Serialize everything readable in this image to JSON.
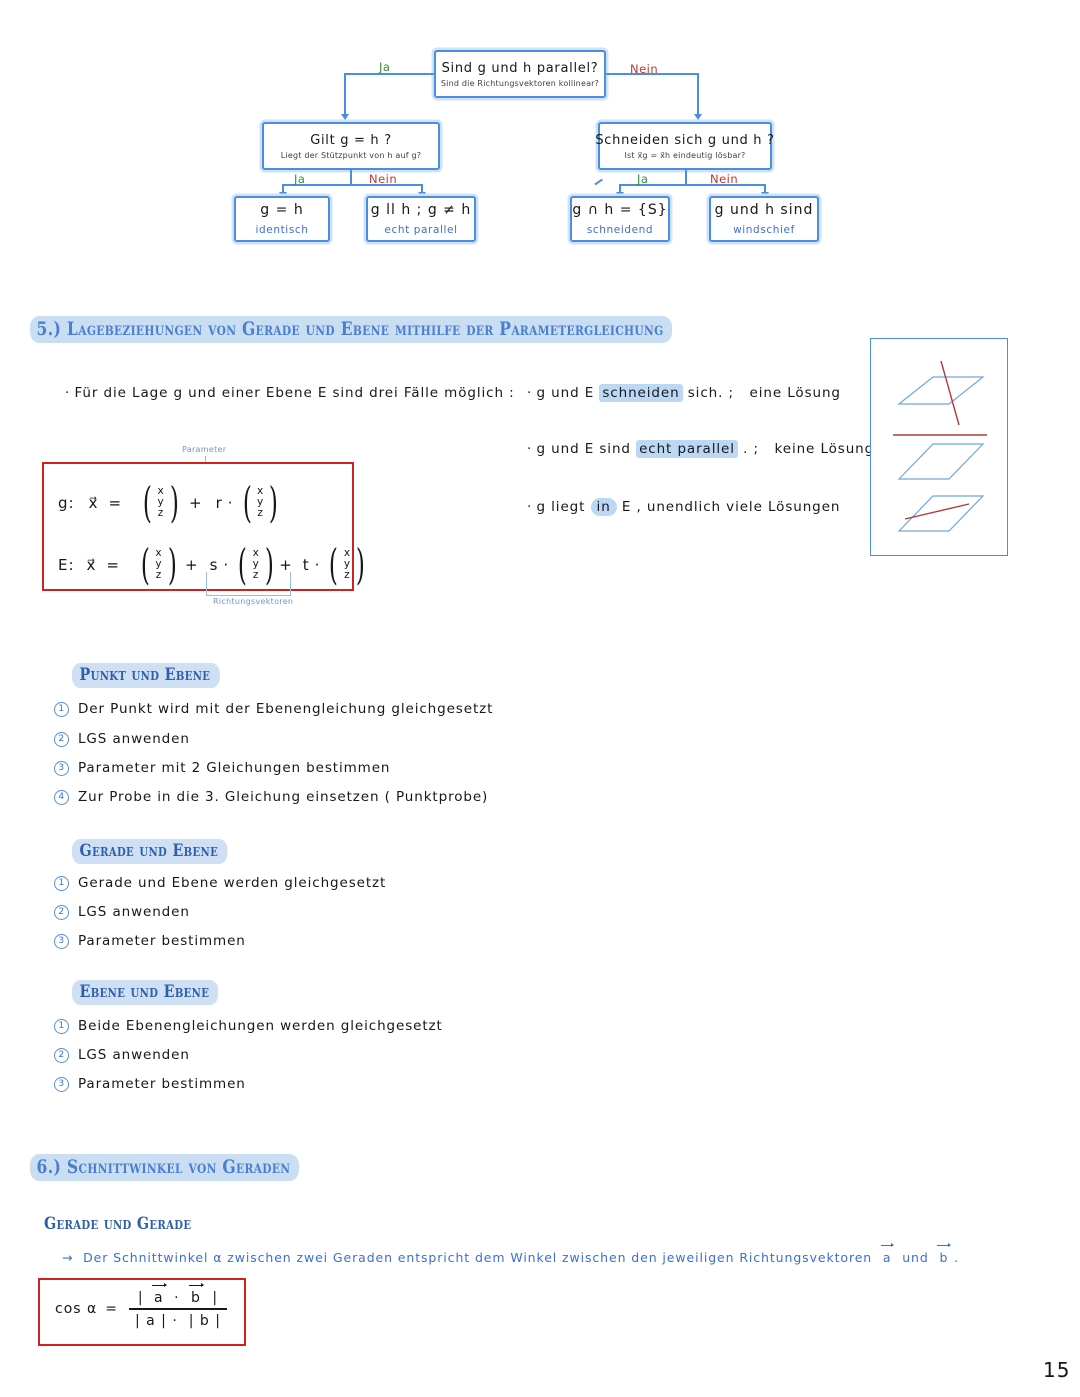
{
  "page": {
    "number": "15"
  },
  "flowchart": {
    "root": {
      "main": "Sind g und h parallel?",
      "sub": "Sind die Richtungsvektoren kollinear?"
    },
    "left_branch_label": "Ja",
    "right_branch_label": "Nein",
    "left_node": {
      "main": "Gilt g = h ?",
      "sub": "Liegt der Stützpunkt von h auf g?"
    },
    "right_node": {
      "main": "Schneiden sich g und h ?",
      "sub": "Ist x⃗g = x⃗h eindeutig lösbar?"
    },
    "left_yes_label": "Ja",
    "left_no_label": "Nein",
    "right_yes_label": "Ja",
    "right_no_label": "Nein",
    "leaves": [
      {
        "main": "g = h",
        "sub": "identisch"
      },
      {
        "main": "g ll h ; g ≠ h",
        "sub": "echt parallel"
      },
      {
        "main": "g ∩ h = {S}",
        "sub": "schneidend"
      },
      {
        "main": "g und h sind",
        "sub": "windschief"
      }
    ]
  },
  "section5": {
    "heading": "5.) Lagebeziehungen von Gerade und Ebene mithilfe der Parametergleichung",
    "intro": "Für die Lage g und einer Ebene E sind drei Fälle möglich :",
    "cases": [
      {
        "pre": "g und E",
        "mark": "schneiden",
        "post": "sich. ;",
        "result": "eine Lösung"
      },
      {
        "pre": "g und E sind",
        "mark": "echt parallel",
        "post": ". ;",
        "result": "keine Lösung"
      },
      {
        "pre": "g liegt",
        "mark": "in",
        "post": "E , unendlich viele Lösungen",
        "result": ""
      }
    ],
    "equations": {
      "line_label": "g:",
      "plane_label": "E:",
      "lhs": "x⃗",
      "eq": "=",
      "vector_components": [
        "x",
        "y",
        "z"
      ],
      "line_param": "r",
      "plane_param1": "s",
      "plane_param2": "t",
      "annotation_top": "Parameter",
      "annotation_bottom": "Richtungsvektoren"
    }
  },
  "punkt_ebene": {
    "heading": "Punkt und Ebene",
    "steps": [
      {
        "num": "1",
        "text": "Der Punkt wird mit der Ebenengleichung gleichgesetzt"
      },
      {
        "num": "2",
        "text": "LGS anwenden"
      },
      {
        "num": "3",
        "text": "Parameter mit 2 Gleichungen bestimmen"
      },
      {
        "num": "4",
        "text": "Zur Probe in die 3. Gleichung einsetzen ( Punktprobe)"
      }
    ]
  },
  "gerade_ebene": {
    "heading": "Gerade und Ebene",
    "steps": [
      {
        "num": "1",
        "text": "Gerade und Ebene werden gleichgesetzt"
      },
      {
        "num": "2",
        "text": "LGS anwenden"
      },
      {
        "num": "3",
        "text": "Parameter bestimmen"
      }
    ]
  },
  "ebene_ebene": {
    "heading": "Ebene und Ebene",
    "steps": [
      {
        "num": "1",
        "text": "Beide Ebenengleichungen werden gleichgesetzt"
      },
      {
        "num": "2",
        "text": "LGS anwenden"
      },
      {
        "num": "3",
        "text": "Parameter bestimmen"
      }
    ]
  },
  "section6": {
    "heading": "6.) Schnittwinkel von Geraden",
    "subheading": "Gerade und Gerade",
    "arrow": "→",
    "statement_part1": "Der Schnittwinkel α zwischen zwei Geraden entspricht dem Winkel zwischen den jeweiligen Richtungsvektoren",
    "statement_vec_a": "a",
    "statement_und": "und",
    "statement_vec_b": "b",
    "statement_end": ".",
    "formula": {
      "lhs": "cos α",
      "eq": "=",
      "numerator_open": "|",
      "numerator_a": "a",
      "numerator_dot": "·",
      "numerator_b": "b",
      "numerator_close": "|",
      "denominator_a": "| a | ·",
      "denominator_b": "| b |"
    }
  },
  "colors": {
    "blue_ink": "#3b6fd4",
    "box_blue": "#4a8ee0",
    "highlight": "#bcd8f4",
    "red_box": "#cc2222",
    "green_label": "#3b8f3b",
    "red_label": "#c0392b",
    "heading_blue": "#4a7fd0"
  }
}
